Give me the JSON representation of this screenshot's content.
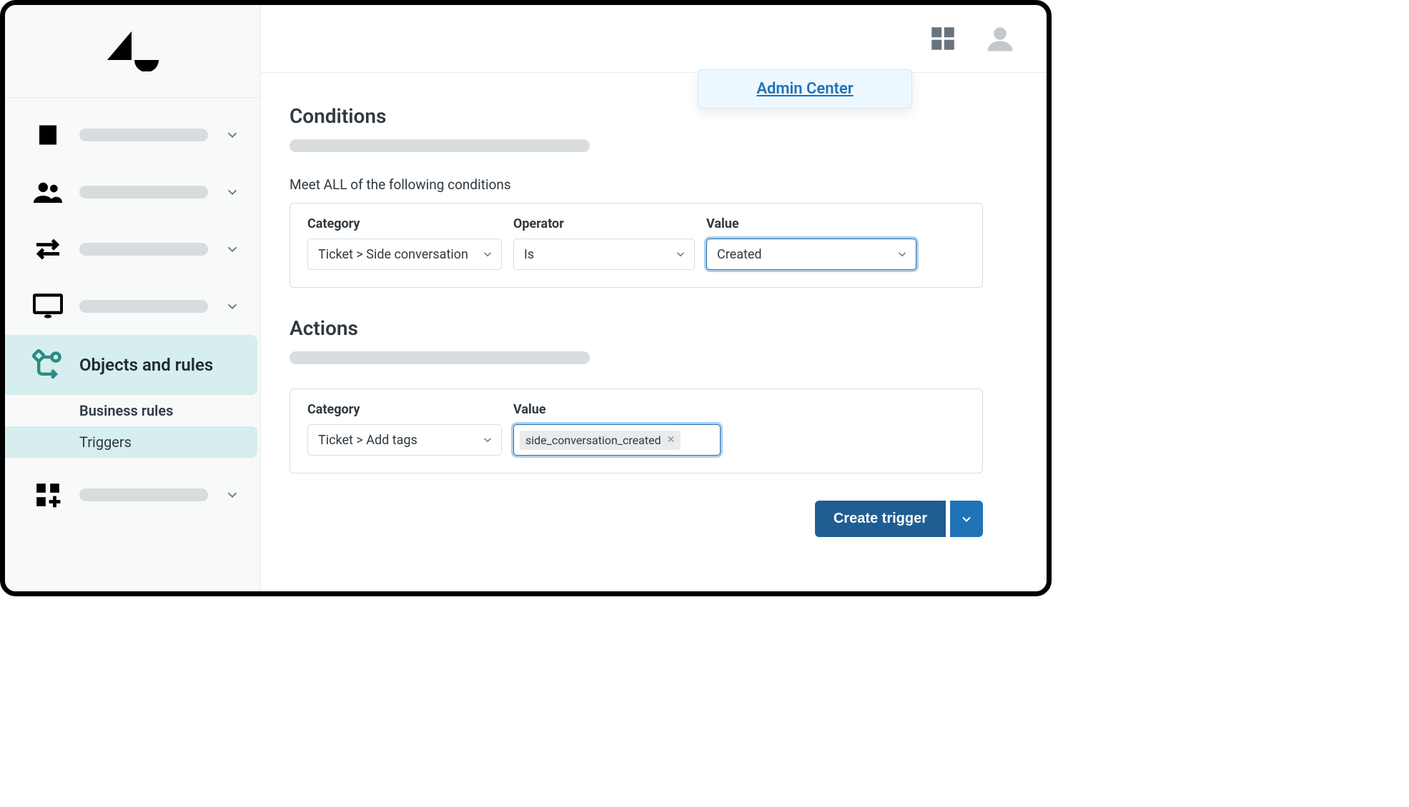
{
  "header": {
    "admin_center_link": "Admin Center"
  },
  "sidebar": {
    "active_label": "Objects and rules",
    "sub_items": [
      {
        "label": "Business rules",
        "active": false
      },
      {
        "label": "Triggers",
        "active": true
      }
    ]
  },
  "conditions": {
    "heading": "Conditions",
    "meet_all_label": "Meet ALL of the following conditions",
    "columns": {
      "category": "Category",
      "operator": "Operator",
      "value": "Value"
    },
    "row": {
      "category": "Ticket > Side conversation",
      "operator": "Is",
      "value": "Created"
    }
  },
  "actions": {
    "heading": "Actions",
    "columns": {
      "category": "Category",
      "value": "Value"
    },
    "row": {
      "category": "Ticket > Add tags",
      "tags": [
        "side_conversation_created"
      ]
    }
  },
  "footer": {
    "create_label": "Create trigger"
  }
}
